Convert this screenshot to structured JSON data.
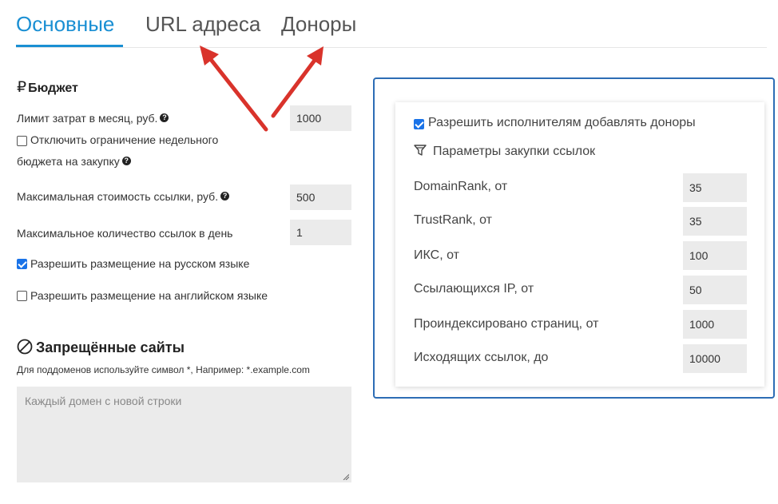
{
  "tabs": [
    {
      "label": "Основные",
      "active": true
    },
    {
      "label": "URL адреса",
      "active": false
    },
    {
      "label": "Доноры",
      "active": false
    }
  ],
  "budget": {
    "title": "Бюджет",
    "currency_symbol": "₽",
    "monthly_limit_label": "Лимит затрат в месяц, руб.",
    "monthly_limit_value": "1000",
    "disable_weekly_limit_label_line1": "Отключить ограничение недельного",
    "disable_weekly_limit_label_line2": "бюджета на закупку",
    "disable_weekly_limit_checked": false,
    "max_link_cost_label": "Максимальная стоимость ссылки, руб.",
    "max_link_cost_value": "500",
    "max_links_per_day_label": "Максимальное количество ссылок в день",
    "max_links_per_day_value": "1",
    "allow_russian_label": "Разрешить размещение на русском языке",
    "allow_russian_checked": true,
    "allow_english_label": "Разрешить размещение на английском языке",
    "allow_english_checked": false,
    "help_icon_glyph": "?"
  },
  "forbidden": {
    "title": "Запрещённые сайты",
    "hint": "Для поддоменов используйте символ *, Например: *.example.com",
    "placeholder": "Каждый домен с новой строки"
  },
  "donors_panel": {
    "allow_executors_label": "Разрешить исполнителям добавлять доноры",
    "allow_executors_checked": true,
    "params_title": "Параметры закупки ссылок",
    "fields": [
      {
        "label": "DomainRank, от",
        "value": "35"
      },
      {
        "label": "TrustRank, от",
        "value": "35"
      },
      {
        "label": "ИКС, от",
        "value": "100"
      },
      {
        "label": "Ссылающихся IP, от",
        "value": "50"
      },
      {
        "label": "Проиндексировано страниц, от",
        "value": "1000"
      },
      {
        "label": "Исходящих ссылок, до",
        "value": "10000"
      }
    ]
  },
  "colors": {
    "accent": "#1a8fd3",
    "panel_border": "#2d6db5",
    "arrow": "#d9332b",
    "input_bg": "#ebebeb"
  }
}
